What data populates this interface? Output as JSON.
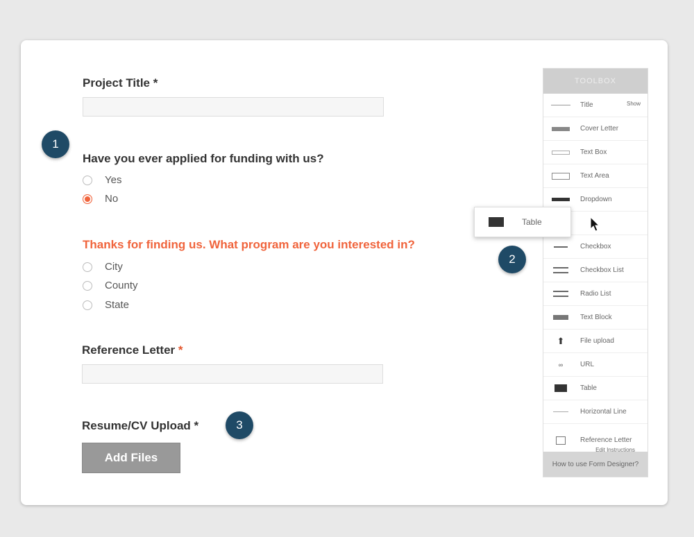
{
  "form": {
    "project_title": {
      "label": "Project Title",
      "required": "*"
    },
    "funding_question": {
      "label": "Have you ever applied for funding with us?",
      "options": [
        "Yes",
        "No"
      ],
      "selected": "No"
    },
    "program_question": {
      "label": "Thanks for finding us. What program are you interested in?",
      "options": [
        "City",
        "County",
        "State"
      ]
    },
    "reference_letter": {
      "label": "Reference Letter",
      "required": "*"
    },
    "resume_upload": {
      "label": "Resume/CV Upload",
      "required": "*",
      "button": "Add Files"
    }
  },
  "badges": [
    "1",
    "2",
    "3"
  ],
  "toolbox": {
    "header": "TOOLBOX",
    "show_label": "Show",
    "items": [
      {
        "label": "Title",
        "icon": "title-line-icon"
      },
      {
        "label": "Cover Letter",
        "icon": "cover-letter-icon"
      },
      {
        "label": "Text Box",
        "icon": "text-box-icon"
      },
      {
        "label": "Text Area",
        "icon": "text-area-icon"
      },
      {
        "label": "Dropdown",
        "icon": "dropdown-icon"
      },
      {
        "label": "",
        "icon": ""
      },
      {
        "label": "Checkbox",
        "icon": "checkbox-icon"
      },
      {
        "label": "Checkbox List",
        "icon": "checkbox-list-icon"
      },
      {
        "label": "Radio List",
        "icon": "radio-list-icon"
      },
      {
        "label": "Text Block",
        "icon": "text-block-icon"
      },
      {
        "label": "File upload",
        "icon": "upload-icon"
      },
      {
        "label": "URL",
        "icon": "link-icon"
      },
      {
        "label": "Table",
        "icon": "table-icon"
      },
      {
        "label": "Horizontal Line",
        "icon": "horizontal-line-icon"
      },
      {
        "label": "Reference Letter",
        "icon": "reference-letter-icon",
        "sub": "Edit Instructions"
      }
    ],
    "footer": "How to use Form Designer?"
  },
  "dragging": {
    "label": "Table",
    "icon": "table-icon"
  },
  "colors": {
    "accent": "#e4552b",
    "badge": "#1f4a66"
  }
}
